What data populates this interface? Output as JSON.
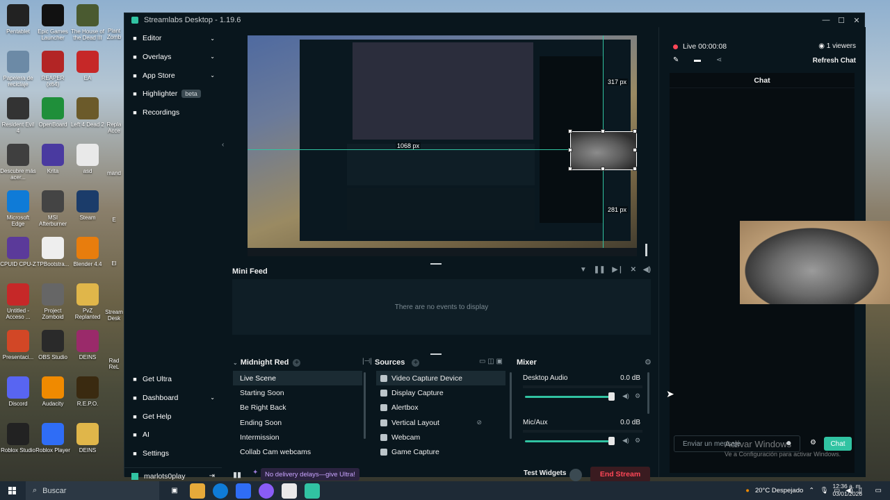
{
  "desktop": {
    "icons": [
      {
        "label": "Pentablet",
        "color": "#222"
      },
      {
        "label": "Epic Games Launcher",
        "color": "#111"
      },
      {
        "label": "The House of the Dead III",
        "color": "#4a5a30"
      },
      {
        "label": "Papelera de reciclaje",
        "color": "#6c8aa6"
      },
      {
        "label": "REAPER (x64)",
        "color": "#b32525"
      },
      {
        "label": "EA",
        "color": "#c62828"
      },
      {
        "label": "Resident Evil 4",
        "color": "#333"
      },
      {
        "label": "OpenBoard",
        "color": "#1f8f3a"
      },
      {
        "label": "Left 4 Dead 2",
        "color": "#6b5a2a"
      },
      {
        "label": "Descubre más acer...",
        "color": "#3f3f3f"
      },
      {
        "label": "Krita",
        "color": "#4a3aa0"
      },
      {
        "label": "asd",
        "color": "#e9e9e9"
      },
      {
        "label": "Microsoft Edge",
        "color": "#0f7bd7"
      },
      {
        "label": "MSI Afterburner",
        "color": "#444"
      },
      {
        "label": "Steam",
        "color": "#1b3c6a"
      },
      {
        "label": "CPUID CPU-Z",
        "color": "#5b3a9a"
      },
      {
        "label": "TPBootstra...",
        "color": "#eee"
      },
      {
        "label": "Blender 4.4",
        "color": "#e87d0d"
      },
      {
        "label": "Untitled - Acceso ...",
        "color": "#c62828"
      },
      {
        "label": "Project Zomboid",
        "color": "#666"
      },
      {
        "label": "PvZ Replanted",
        "color": "#e0b64a"
      },
      {
        "label": "Presentaci...",
        "color": "#d24726"
      },
      {
        "label": "OBS Studio",
        "color": "#2a2a2a"
      },
      {
        "label": "DEINS",
        "color": "#9a2a6a"
      },
      {
        "label": "Discord",
        "color": "#5865f2"
      },
      {
        "label": "Audacity",
        "color": "#f08a00"
      },
      {
        "label": "R.E.P.O.",
        "color": "#3a2a10"
      },
      {
        "label": "Roblox Studio",
        "color": "#222"
      },
      {
        "label": "Roblox Player",
        "color": "#2f6df6"
      },
      {
        "label": "DEINS",
        "color": "#e0b64a"
      }
    ],
    "partial_labels": [
      "Plant Zomb",
      "Repla Acce",
      "mand",
      "Stream Desk",
      "Rad ReL",
      "E",
      "El"
    ]
  },
  "window": {
    "title": "Streamlabs Desktop - 1.19.6",
    "controls": {
      "minimize": "—",
      "maximize": "☐",
      "close": "✕"
    }
  },
  "sidebar": {
    "items": [
      {
        "label": "Editor",
        "icon": "grid-icon",
        "chevron": true
      },
      {
        "label": "Overlays",
        "icon": "overlays-icon",
        "chevron": true
      },
      {
        "label": "App Store",
        "icon": "store-icon",
        "chevron": true
      },
      {
        "label": "Highlighter",
        "icon": "highlighter-icon",
        "badge": "beta"
      },
      {
        "label": "Recordings",
        "icon": "record-icon"
      }
    ],
    "bottom_items": [
      {
        "label": "Get Ultra",
        "icon": "ultra-icon"
      },
      {
        "label": "Dashboard",
        "icon": "dashboard-icon",
        "chevron": true
      },
      {
        "label": "Get Help",
        "icon": "help-icon"
      },
      {
        "label": "AI",
        "icon": "ai-icon"
      },
      {
        "label": "Settings",
        "icon": "gear-icon"
      }
    ],
    "user": "marlots0play"
  },
  "preview": {
    "measure_top": "317 px",
    "measure_left": "1068 px",
    "measure_bottom": "281 px"
  },
  "minifeed": {
    "title": "Mini Feed",
    "empty_text": "There are no events to display"
  },
  "scenes": {
    "title": "Midnight Red",
    "items": [
      "Live Scene",
      "Starting Soon",
      "Be Right Back",
      "Ending Soon",
      "Intermission",
      "Collab Cam webcams"
    ],
    "selected": "Live Scene"
  },
  "sources": {
    "title": "Sources",
    "items": [
      "Video Capture Device",
      "Display Capture",
      "Alertbox",
      "Vertical Layout",
      "Webcam",
      "Game Capture"
    ],
    "selected": "Video Capture Device"
  },
  "mixer": {
    "title": "Mixer",
    "channels": [
      {
        "name": "Desktop Audio",
        "db": "0.0 dB",
        "level": 1.0
      },
      {
        "name": "Mic/Aux",
        "db": "0.0 dB",
        "level": 1.0
      }
    ]
  },
  "footer": {
    "promo": "No delivery delays—give Ultra!",
    "test_widgets": "Test Widgets",
    "end_stream": "End Stream"
  },
  "chat_panel": {
    "live_status": "Live 00:00:08",
    "viewers": "1 viewers",
    "refresh": "Refresh Chat",
    "chat_title": "Chat",
    "input_placeholder": "Enviar un mensaje",
    "send_label": "Chat"
  },
  "watermark": {
    "title": "Activar Windows",
    "subtitle": "Ve a Configuración para activar Windows."
  },
  "taskbar": {
    "search_placeholder": "Buscar",
    "weather": "20°C  Despejado",
    "time": "12:36 a. m.",
    "date": "03/01/2026"
  },
  "colors": {
    "accent": "#31c3a2",
    "live": "#ff4757",
    "bg": "#09161d",
    "promo": "#c9a4ff"
  }
}
